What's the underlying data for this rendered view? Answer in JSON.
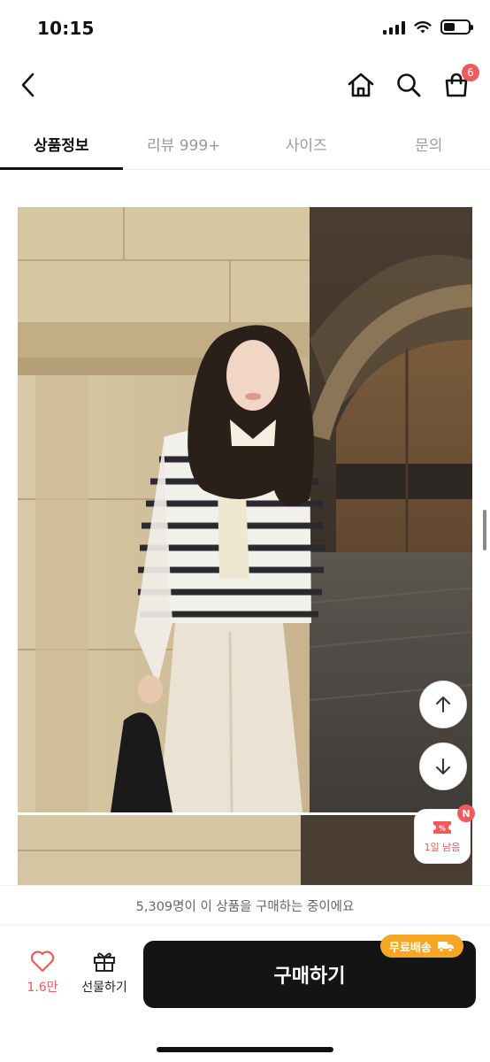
{
  "status_bar": {
    "time": "10:15"
  },
  "header": {
    "cart_count": "6"
  },
  "tabs": [
    {
      "label": "상품정보",
      "active": true
    },
    {
      "label": "리뷰 999+",
      "active": false
    },
    {
      "label": "사이즈",
      "active": false
    },
    {
      "label": "문의",
      "active": false
    }
  ],
  "product_images": [
    {
      "subject": "woman in striped cardigan and white wide pants standing by stone pillar"
    },
    {
      "subject": "continuation of product photo"
    }
  ],
  "floating": {
    "scroll_up_icon": "arrow-up-icon",
    "scroll_down_icon": "arrow-down-icon",
    "coupon_label": "1일 남음",
    "coupon_badge": "N"
  },
  "notice": {
    "text": "5,309명이 이 상품을 구매하는 중이에요"
  },
  "bottom_bar": {
    "like_count": "1.6만",
    "gift_label": "선물하기",
    "buy_label": "구매하기",
    "shipping_badge": "무료배송"
  },
  "colors": {
    "accent_red": "#f05a5a",
    "buy_button": "#141414",
    "shipping_orange": "#f6a623"
  }
}
